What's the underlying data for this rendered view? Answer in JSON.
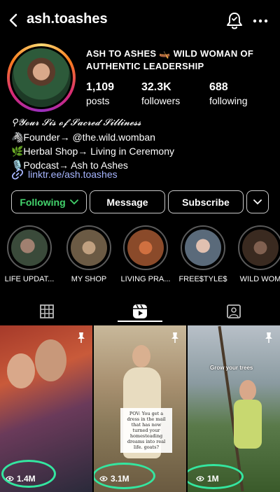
{
  "header": {
    "username": "ash.toashes"
  },
  "profile": {
    "display_name": "ASH TO ASHES 🛶 WILD WOMAN OF AUTHENTIC LEADERSHIP",
    "stats": [
      {
        "value": "1,109",
        "label": "posts"
      },
      {
        "value": "32.3K",
        "label": "followers"
      },
      {
        "value": "688",
        "label": "following"
      }
    ],
    "bio_lines": [
      "⚲𝓨𝓸𝓾𝓻 𝓢𝓲𝓼 𝓸𝓯 𝓢𝓪𝓬𝓻𝓮𝓭 𝓢𝓲𝓵𝓵𝓲𝓷𝓮𝓼𝓼",
      "🦓Founder→ @the.wild.womban",
      "🌿Herbal Shop→ Living in Ceremony",
      "🎙️Podcast→ Ash to Ashes"
    ],
    "link": "linktr.ee/ash.toashes"
  },
  "buttons": {
    "following": "Following",
    "message": "Message",
    "subscribe": "Subscribe"
  },
  "highlights": [
    {
      "label": "LIFE UPDAT...",
      "color": "#3a4a3a"
    },
    {
      "label": "MY SHOP",
      "color": "#6b5a44"
    },
    {
      "label": "LIVING PRA...",
      "color": "#8a4a2a"
    },
    {
      "label": "FREE$TYLE$",
      "color": "#5a6a7a"
    },
    {
      "label": "WILD WOM",
      "color": "#3a2a20"
    }
  ],
  "tabs": {
    "active": "reels",
    "items": [
      "grid",
      "reels",
      "tagged"
    ]
  },
  "reels": [
    {
      "views": "1.4M",
      "pinned": true
    },
    {
      "views": "3.1M",
      "pinned": true,
      "caption": "POV: You get a dress in the mail that has now turned your homesteading dreams into real life. goats?"
    },
    {
      "views": "1M",
      "pinned": true,
      "overlay_text": "Grow your trees"
    }
  ],
  "colors": {
    "following_green": "#43d36c",
    "link_blue": "#a7b6ff",
    "annotation_green": "#34e6a0"
  }
}
